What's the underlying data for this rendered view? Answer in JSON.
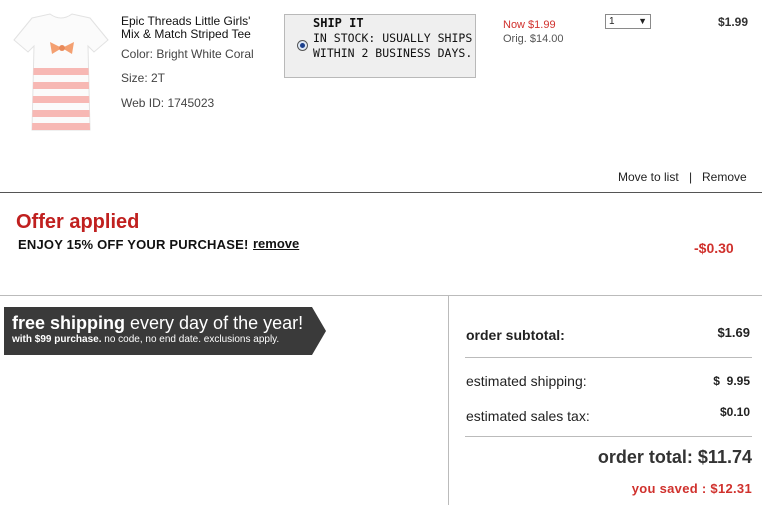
{
  "item": {
    "name": "Epic Threads Little Girls' Mix & Match Striped Tee",
    "color": "Color: Bright White Coral",
    "size": "Size: 2T",
    "web_id": "Web ID: 1745023",
    "ship_option_title": "SHIP IT",
    "ship_option_message": "IN STOCK: USUALLY SHIPS WITHIN 2 BUSINESS DAYS.",
    "price_now": "Now $1.99",
    "price_orig": "Orig. $14.00",
    "quantity": "1",
    "line_total": "$1.99",
    "move_to_list": "Move to list",
    "separator": "|",
    "remove": "Remove"
  },
  "offer": {
    "title": "Offer applied",
    "description": "ENJOY 15% OFF YOUR PURCHASE!",
    "remove_link": "remove",
    "amount": "-$0.30"
  },
  "banner": {
    "headline_bold": "free shipping",
    "headline_rest": " every day of the year!",
    "sub_bold": "with $99 purchase.",
    "sub_rest": " no code, no end date. exclusions apply."
  },
  "summary": {
    "subtotal_label": "order subtotal:",
    "subtotal_value": "$1.69",
    "shipping_label": "estimated shipping:",
    "shipping_value": "$  9.95",
    "tax_label": "estimated sales tax:",
    "tax_value": "$0.10",
    "total": "order total: $11.74",
    "saved": "you saved : $12.31"
  },
  "colors": {
    "accent_red": "#d0312d",
    "offer_red": "#c0201f",
    "banner_bg": "#3a3a3a"
  }
}
